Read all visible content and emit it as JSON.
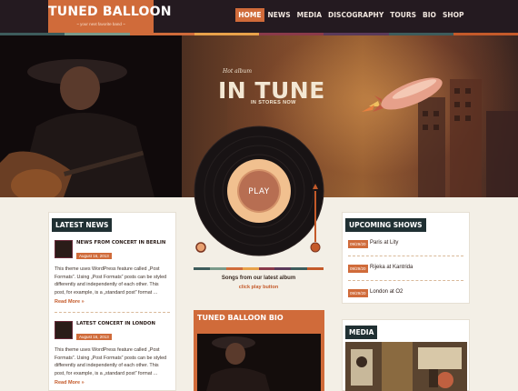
{
  "header": {
    "logo_title": "TUNED BALLOON",
    "logo_tagline": "~ your next favorite band ~",
    "nav": [
      "HOME",
      "NEWS",
      "MEDIA",
      "DISCOGRAPHY",
      "TOURS",
      "BIO",
      "SHOP"
    ],
    "active_nav": "HOME"
  },
  "hero": {
    "album_sub": "Hot album",
    "album_title": "IN TUNE",
    "album_stores": "IN STORES NOW"
  },
  "player": {
    "play_label": "PLAY",
    "songs_label": "Songs from our latest album",
    "click_play": "click play button"
  },
  "news": {
    "title": "LATEST NEWS",
    "items": [
      {
        "heading": "NEWS FROM CONCERT IN BERLIN",
        "date": "August 16, 2013",
        "text": "This theme uses WordPress feature called „Post Formats”. Using „Post Formats” posts can be styled differently and independently of each other. This post, for example, is a „standard post” format ...",
        "more": "Read More »"
      },
      {
        "heading": "LATEST CONCERT IN LONDON",
        "date": "August 16, 2013",
        "text": "This theme uses WordPress feature called „Post Formats”. Using „Post Formats” posts can be styled differently and independently of each other. This post, for example, is a „standard post” format ...",
        "more": "Read More »"
      }
    ]
  },
  "bio": {
    "title": "TUNED BALLOON BIO"
  },
  "shows": {
    "title": "UPCOMING SHOWS",
    "items": [
      {
        "date": "09/29/20",
        "venue": "Paris at Lity"
      },
      {
        "date": "09/29/20",
        "venue": "Rijeka at Kantrida"
      },
      {
        "date": "09/29/20",
        "venue": "London at O2"
      }
    ]
  },
  "media": {
    "title": "MEDIA"
  },
  "colors": {
    "accent": "#d06b3a",
    "dark": "#241a20",
    "section_title_bg": "#203033",
    "stripe": [
      "#3d5c5c",
      "#7a9a8a",
      "#d06b3a",
      "#e8a24a",
      "#8a3a4a",
      "#5a3a5a",
      "#3d5c5c",
      "#c45a2a"
    ]
  }
}
